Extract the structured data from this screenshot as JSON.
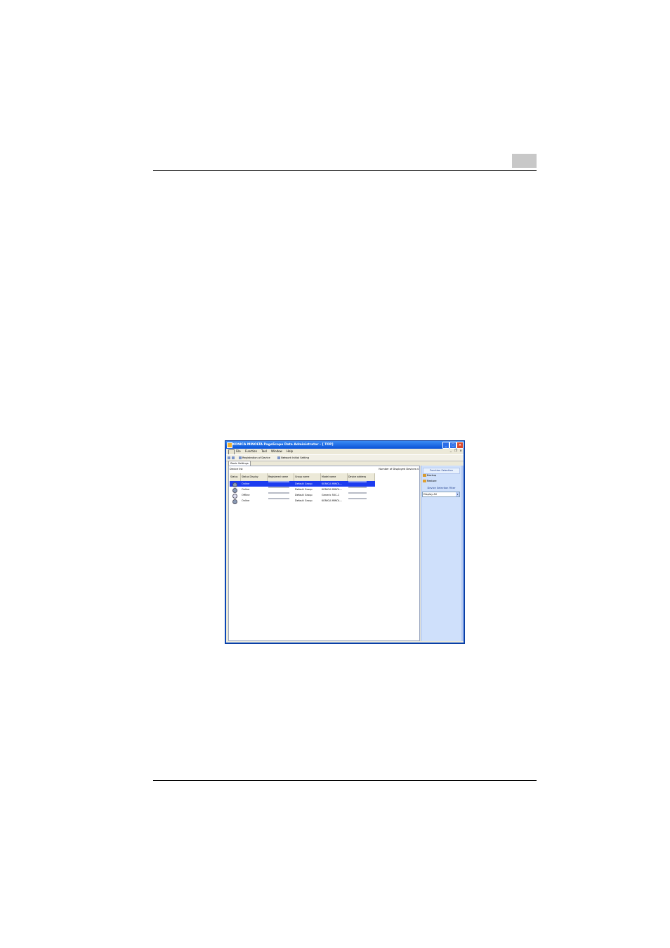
{
  "window": {
    "title": "KONICA MINOLTA PageScope Data Administrator - [ TOP]",
    "min_glyph": "_",
    "max_glyph": "□",
    "close_glyph": "×"
  },
  "menu": {
    "items": [
      "File",
      "Function",
      "Tool",
      "Window",
      "Help"
    ],
    "mdi_min": "_",
    "mdi_restore": "❐",
    "mdi_close": "×"
  },
  "toolbar": {
    "register_label": "Registration of Device",
    "network_label": "Network Initial Setting"
  },
  "tabs": {
    "active": "Basic Settings"
  },
  "device_list": {
    "label": "Device list",
    "count_label": "Number of Displayed Devices:4",
    "columns": [
      "Status",
      "Status Display",
      "Registered name",
      "Group name",
      "Model name",
      "Device address"
    ],
    "rows": [
      {
        "status_display": "Online",
        "group": "Default Group",
        "model": "KONICA MINOL...",
        "selected": true,
        "online": true
      },
      {
        "status_display": "Online",
        "group": "Default Group",
        "model": "KONICA MINOL...",
        "selected": false,
        "online": true
      },
      {
        "status_display": "Offline",
        "group": "Default Group",
        "model": "Generic 50C-1",
        "selected": false,
        "online": false
      },
      {
        "status_display": "Online",
        "group": "Default Group",
        "model": "KONICA MINOL...",
        "selected": false,
        "online": true
      }
    ]
  },
  "side_panel": {
    "function_header": "Function Selection",
    "backup_label": "Backup",
    "restore_label": "Restore",
    "filter_header": "Device Selection Filter",
    "filter_value": "Display All",
    "filter_arrow": "▾"
  }
}
